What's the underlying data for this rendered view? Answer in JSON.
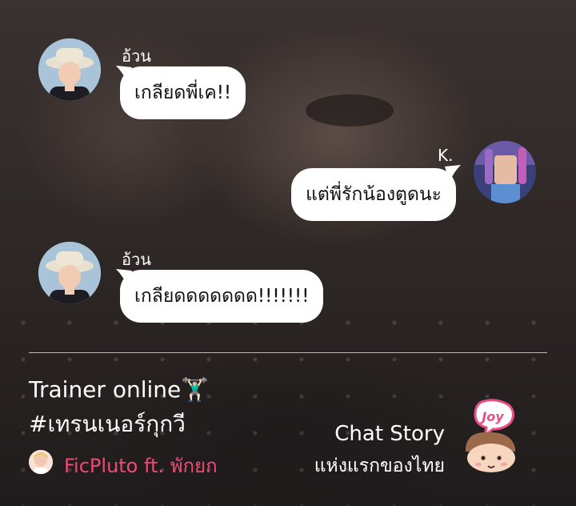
{
  "messages": [
    {
      "sender": "อ้วน",
      "text": "เกลียดพี่เค!!",
      "side": "left"
    },
    {
      "sender": "K.",
      "text": "แต่พี่รักน้องตูดนะ",
      "side": "right"
    },
    {
      "sender": "อ้วน",
      "text": "เกลียดดดดดดด!!!!!!!",
      "side": "left"
    }
  ],
  "story": {
    "title": "Trainer online🏋🏻‍♂",
    "hashtag": "#เทรนเนอร์กุกวี",
    "author": "FicPluto ft. พักยก"
  },
  "brand": {
    "line1": "Chat Story",
    "line2": "แห่งแรกของไทย",
    "logo_text": "Joy"
  },
  "colors": {
    "author": "#ef4a77",
    "logo_bubble": "#e84f86",
    "bubble": "#ffffff"
  }
}
